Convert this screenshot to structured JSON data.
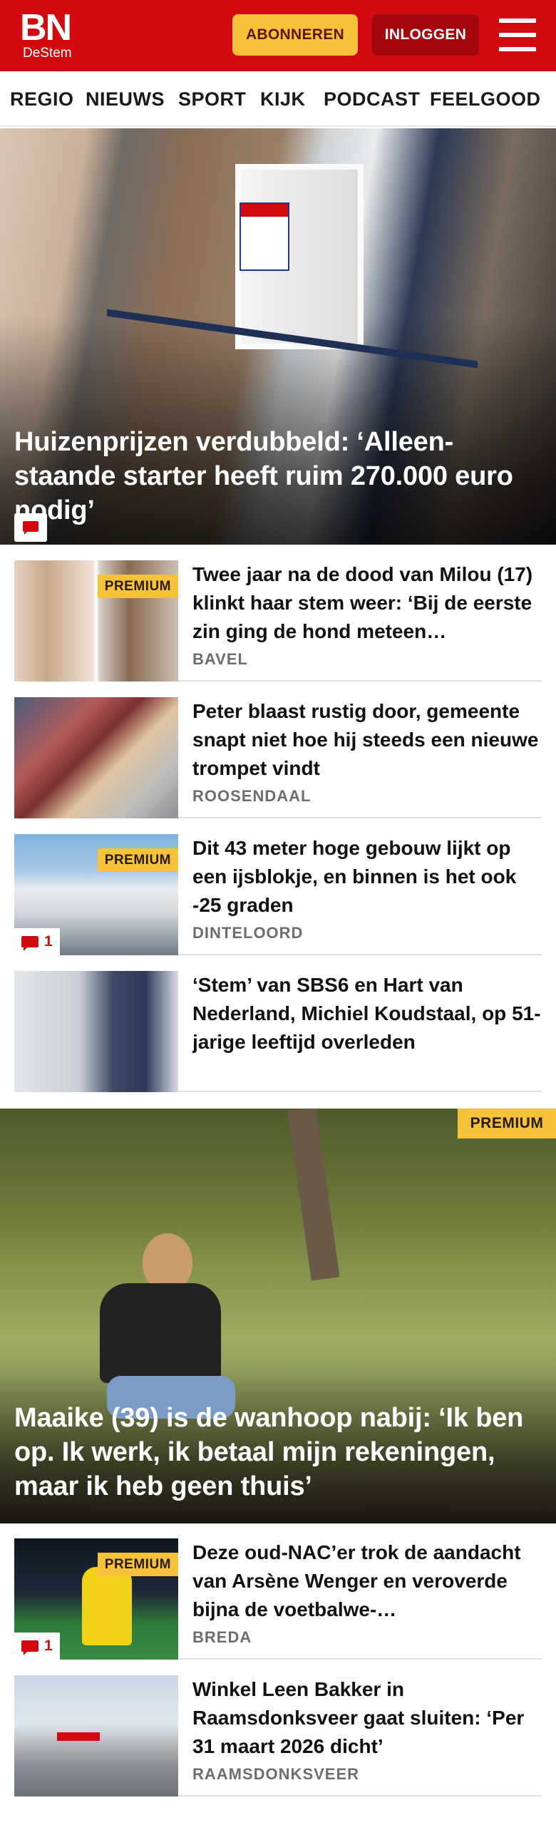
{
  "brand": {
    "name": "BN",
    "sub": "DeStem",
    "color": "#d10a11"
  },
  "header": {
    "subscribe_label": "ABONNEREN",
    "login_label": "INLOGGEN",
    "menu_icon": "hamburger-icon"
  },
  "nav": {
    "items": [
      "REGIO",
      "NIEUWS",
      "SPORT",
      "KIJK",
      "PODCAST",
      "FEELGOOD"
    ]
  },
  "hero1": {
    "title": "Huizenprijzen verdubbeld: ‘Alleen-staande starter heeft ruim 270.000 euro nodig’",
    "comment_icon": "comment-icon"
  },
  "articles_top": [
    {
      "headline": "Twee jaar na de dood van Milou (17) klinkt haar stem weer: ‘Bij de eerste zin ging de hond meteen…",
      "place": "BAVEL",
      "premium": "PREMIUM"
    },
    {
      "headline": "Peter blaast rustig door, gemeente snapt niet hoe hij steeds een nieuwe trompet vindt",
      "place": "ROOSENDAAL"
    },
    {
      "headline": "Dit 43 meter hoge gebouw lijkt op een ijsblokje, en binnen is het ook -25 graden",
      "place": "DINTELOORD",
      "premium": "PREMIUM",
      "comments": "1"
    },
    {
      "headline": "‘Stem’ van SBS6 en Hart van Nederland, Michiel Koudstaal, op 51-jarige leeftijd overleden"
    }
  ],
  "hero2": {
    "title": "Maaike (39) is de wanhoop nabij: ‘Ik ben op. Ik werk, ik betaal mijn rekeningen, maar ik heb geen thuis’",
    "premium": "PREMIUM"
  },
  "articles_bottom": [
    {
      "headline": "Deze oud-NAC’er trok de aandacht van Arsène Wenger en veroverde bijna de voetbalwe-…",
      "place": "BREDA",
      "premium": "PREMIUM",
      "comments": "1"
    },
    {
      "headline": "Winkel Leen Bakker in Raamsdonksveer gaat sluiten: ‘Per 31 maart 2026 dicht’",
      "place": "RAAMSDONKSVEER"
    }
  ]
}
